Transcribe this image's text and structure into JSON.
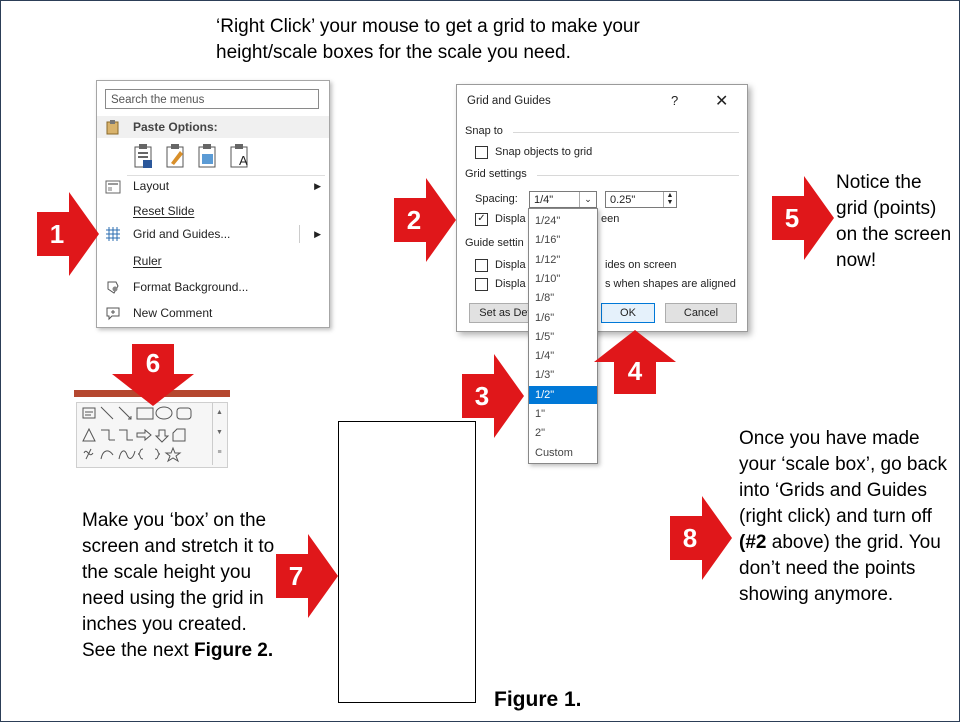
{
  "header_text": "‘Right Click’ your mouse to get a grid to make your height/scale boxes for the scale you need.",
  "step_numbers": [
    "1",
    "2",
    "3",
    "4",
    "5",
    "6",
    "7",
    "8"
  ],
  "context_menu": {
    "search_placeholder": "Search the menus",
    "paste_options": "Paste Options:",
    "items": [
      "Layout",
      "Reset Slide",
      "Grid and Guides...",
      "Ruler",
      "Format Background...",
      "New Comment"
    ]
  },
  "dialog": {
    "title": "Grid and Guides",
    "help": "?",
    "close": "✕",
    "snap_to": "Snap to",
    "snap_objects": "Snap objects to grid",
    "grid_settings": "Grid settings",
    "spacing_label": "Spacing:",
    "spacing_value": "1/4\"",
    "spacing_number": "0.25\"",
    "display_grid_partial": "Displa",
    "display_grid_tail": "een",
    "guide_settings_partial": "Guide settin",
    "display_guides_partial": "Displa",
    "display_guides_tail": "ides on screen",
    "display_smart_partial": "Displa",
    "display_smart_tail": "s when shapes are aligned",
    "set_default_partial": "Set as Defa",
    "ok": "OK",
    "cancel": "Cancel"
  },
  "dropdown_options": [
    "1/24\"",
    "1/16\"",
    "1/12\"",
    "1/10\"",
    "1/8\"",
    "1/6\"",
    "1/5\"",
    "1/4\"",
    "1/3\"",
    "1/2\"",
    "1\"",
    "2\"",
    "Custom"
  ],
  "dropdown_selected_index": 9,
  "step5_text": "Notice the grid (points) on the screen now!",
  "step7_text": {
    "main": "Make you ‘box’ on the screen and stretch it to the scale height you need using the grid in inches you created. See the next ",
    "bold": "Figure 2."
  },
  "step8_text": {
    "part1": "Once you have made your ‘scale box’, go back into ‘Grids and Guides (right click) and turn off ",
    "bold": "(#2",
    "part2": " above) the grid. You don’t need the points showing anymore."
  },
  "figure_caption": "Figure 1.",
  "colors": {
    "arrow_red": "#e0171a",
    "selection_blue": "#0078d7",
    "toolbar_bar": "#b5472f"
  }
}
